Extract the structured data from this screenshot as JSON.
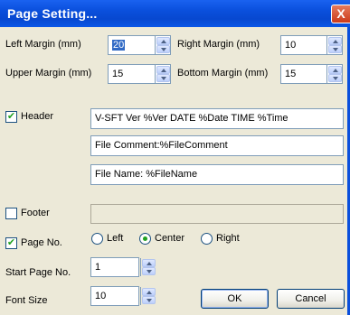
{
  "window": {
    "title": "Page Setting...",
    "close_glyph": "X"
  },
  "margins": {
    "left_label": "Left Margin (mm)",
    "left_value": "20",
    "right_label": "Right Margin (mm)",
    "right_value": "10",
    "upper_label": "Upper Margin (mm)",
    "upper_value": "15",
    "bottom_label": "Bottom Margin (mm)",
    "bottom_value": "15"
  },
  "header": {
    "label": "Header",
    "checked": true,
    "lines": [
      "V-SFT  Ver %Ver  DATE %Date  TIME %Time",
      "File Comment:%FileComment",
      "File Name: %FileName"
    ]
  },
  "footer": {
    "label": "Footer",
    "checked": false,
    "value": ""
  },
  "page_no": {
    "label": "Page No.",
    "checked": true,
    "options": [
      "Left",
      "Center",
      "Right"
    ],
    "selected": "Center"
  },
  "start_page": {
    "label": "Start Page No.",
    "value": "1"
  },
  "font_size": {
    "label": "Font Size",
    "value": "10"
  },
  "buttons": {
    "ok": "OK",
    "cancel": "Cancel"
  },
  "icons": {
    "check": "✔",
    "close": "close-icon",
    "spin_up": "up-arrow-icon",
    "spin_down": "down-arrow-icon"
  },
  "colors": {
    "titlebar": "#0a4fdc",
    "dialog_bg": "#ece9d8",
    "check": "#21a121",
    "close": "#cc3a1a"
  }
}
